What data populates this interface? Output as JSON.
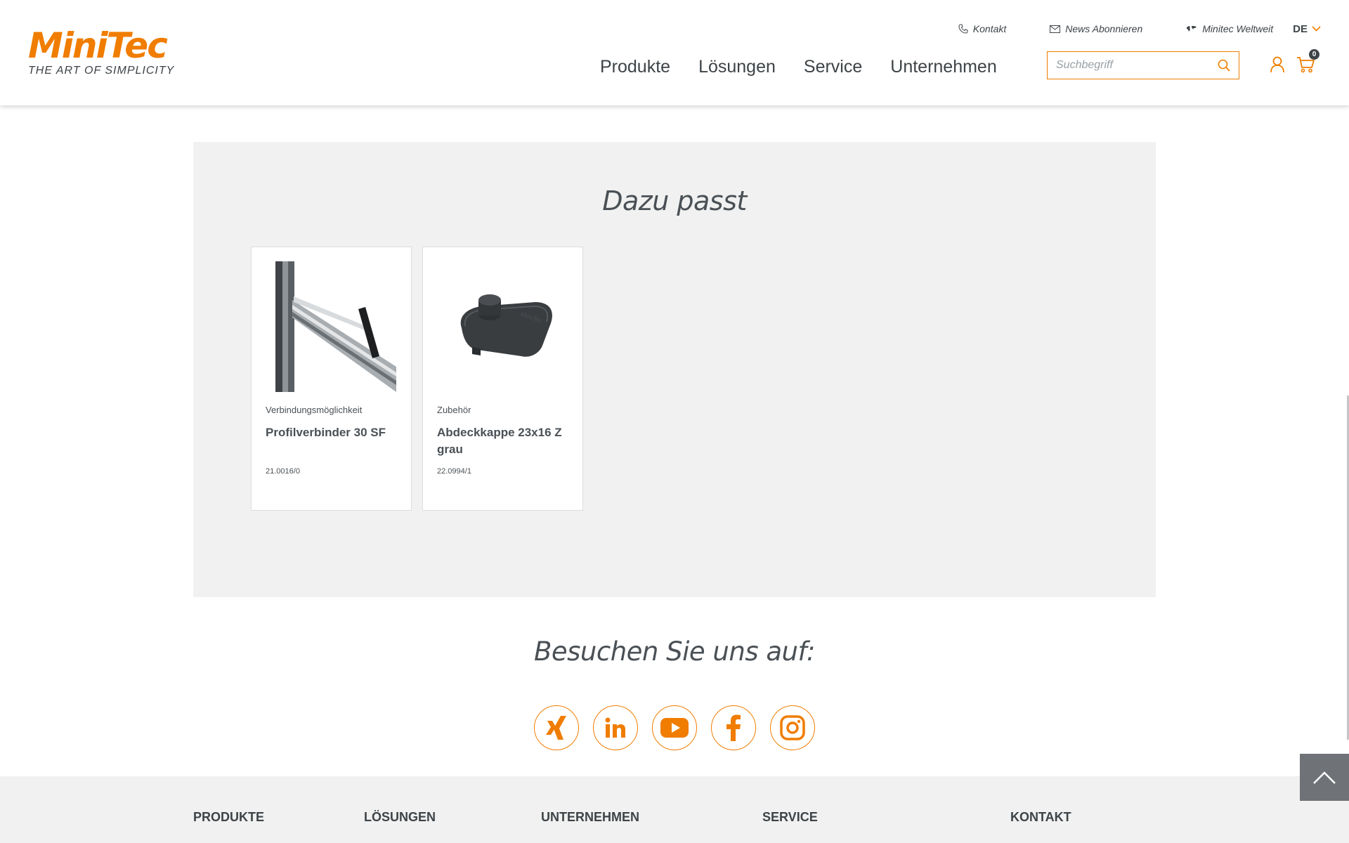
{
  "brand": {
    "name": "MiniTec",
    "tagline": "THE ART OF SIMPLICITY",
    "accent": "#f07d00"
  },
  "topbar": {
    "contact": "Kontakt",
    "newsletter": "News Abonnieren",
    "worldwide": "Minitec Weltweit",
    "language": "DE"
  },
  "nav": [
    "Produkte",
    "Lösungen",
    "Service",
    "Unternehmen"
  ],
  "search": {
    "placeholder": "Suchbegriff"
  },
  "cart": {
    "count": "0"
  },
  "related": {
    "title": "Dazu passt",
    "products": [
      {
        "category": "Verbindungsmöglichkeit",
        "name": "Profilverbinder 30 SF",
        "sku": "21.0016/0",
        "image_icon": "profile-connector-image"
      },
      {
        "category": "Zubehör",
        "name": "Abdeckkappe 23x16 Z grau",
        "sku": "22.0994/1",
        "image_icon": "cover-cap-image"
      }
    ]
  },
  "social": {
    "title": "Besuchen Sie uns auf:",
    "links": [
      "xing",
      "linkedin",
      "youtube",
      "facebook",
      "instagram"
    ]
  },
  "footer": {
    "columns": [
      "PRODUKTE",
      "LÖSUNGEN",
      "UNTERNEHMEN",
      "SERVICE",
      "KONTAKT"
    ]
  }
}
